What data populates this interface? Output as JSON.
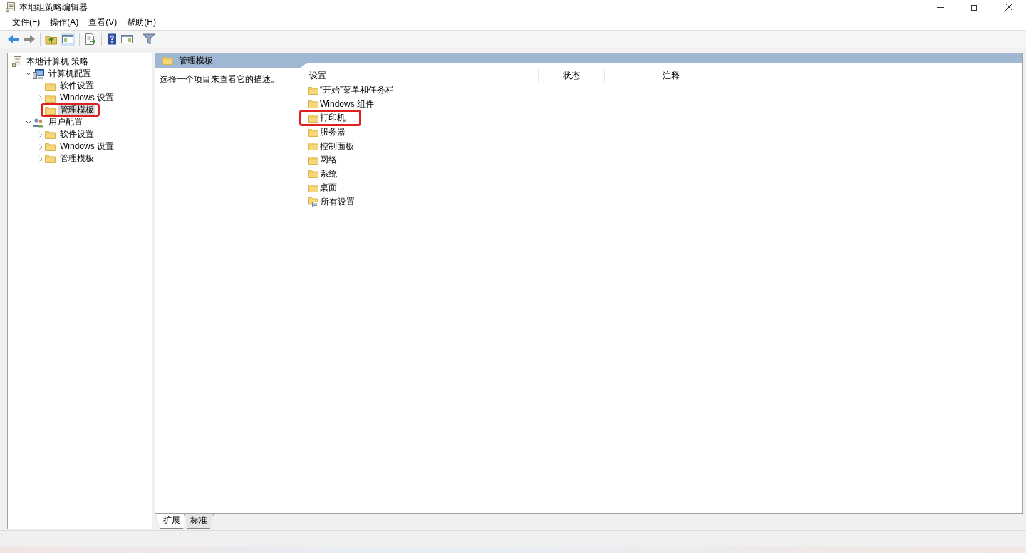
{
  "window": {
    "title": "本地组策略编辑器"
  },
  "menu": [
    "文件(F)",
    "操作(A)",
    "查看(V)",
    "帮助(H)"
  ],
  "tree": {
    "label": "本地计算机 策略",
    "kind": "policy",
    "children": [
      {
        "label": "计算机配置",
        "kind": "computer",
        "expanded": true,
        "selected": false,
        "highlighted": false,
        "children": [
          {
            "label": "软件设置",
            "kind": "folder",
            "selected": false,
            "highlighted": false
          },
          {
            "label": "Windows 设置",
            "kind": "folder",
            "expanded": false,
            "selected": false,
            "highlighted": false
          },
          {
            "label": "管理模板",
            "kind": "folder",
            "selected": true,
            "highlighted": true
          }
        ]
      },
      {
        "label": "用户配置",
        "kind": "users",
        "expanded": true,
        "selected": false,
        "highlighted": false,
        "children": [
          {
            "label": "软件设置",
            "kind": "folder",
            "expanded": false,
            "selected": false,
            "highlighted": false
          },
          {
            "label": "Windows 设置",
            "kind": "folder",
            "expanded": false,
            "selected": false,
            "highlighted": false
          },
          {
            "label": "管理模板",
            "kind": "folder",
            "expanded": false,
            "selected": false,
            "highlighted": false
          }
        ]
      }
    ]
  },
  "details": {
    "header": "管理模板",
    "description": "选择一个项目来查看它的描述。",
    "columns": [
      "设置",
      "状态",
      "注释"
    ],
    "items": [
      {
        "name": "“开始”菜单和任务栏",
        "kind": "folder",
        "highlighted": false
      },
      {
        "name": "Windows 组件",
        "kind": "folder",
        "highlighted": false
      },
      {
        "name": "打印机",
        "kind": "folder",
        "highlighted": true
      },
      {
        "name": "服务器",
        "kind": "folder",
        "highlighted": false
      },
      {
        "name": "控制面板",
        "kind": "folder",
        "highlighted": false
      },
      {
        "name": "网络",
        "kind": "folder",
        "highlighted": false
      },
      {
        "name": "系统",
        "kind": "folder",
        "highlighted": false
      },
      {
        "name": "桌面",
        "kind": "folder",
        "highlighted": false
      },
      {
        "name": "所有设置",
        "kind": "settings",
        "highlighted": false
      }
    ]
  },
  "view_tabs": [
    {
      "label": "扩展",
      "selected": true
    },
    {
      "label": "标准",
      "selected": false
    }
  ]
}
